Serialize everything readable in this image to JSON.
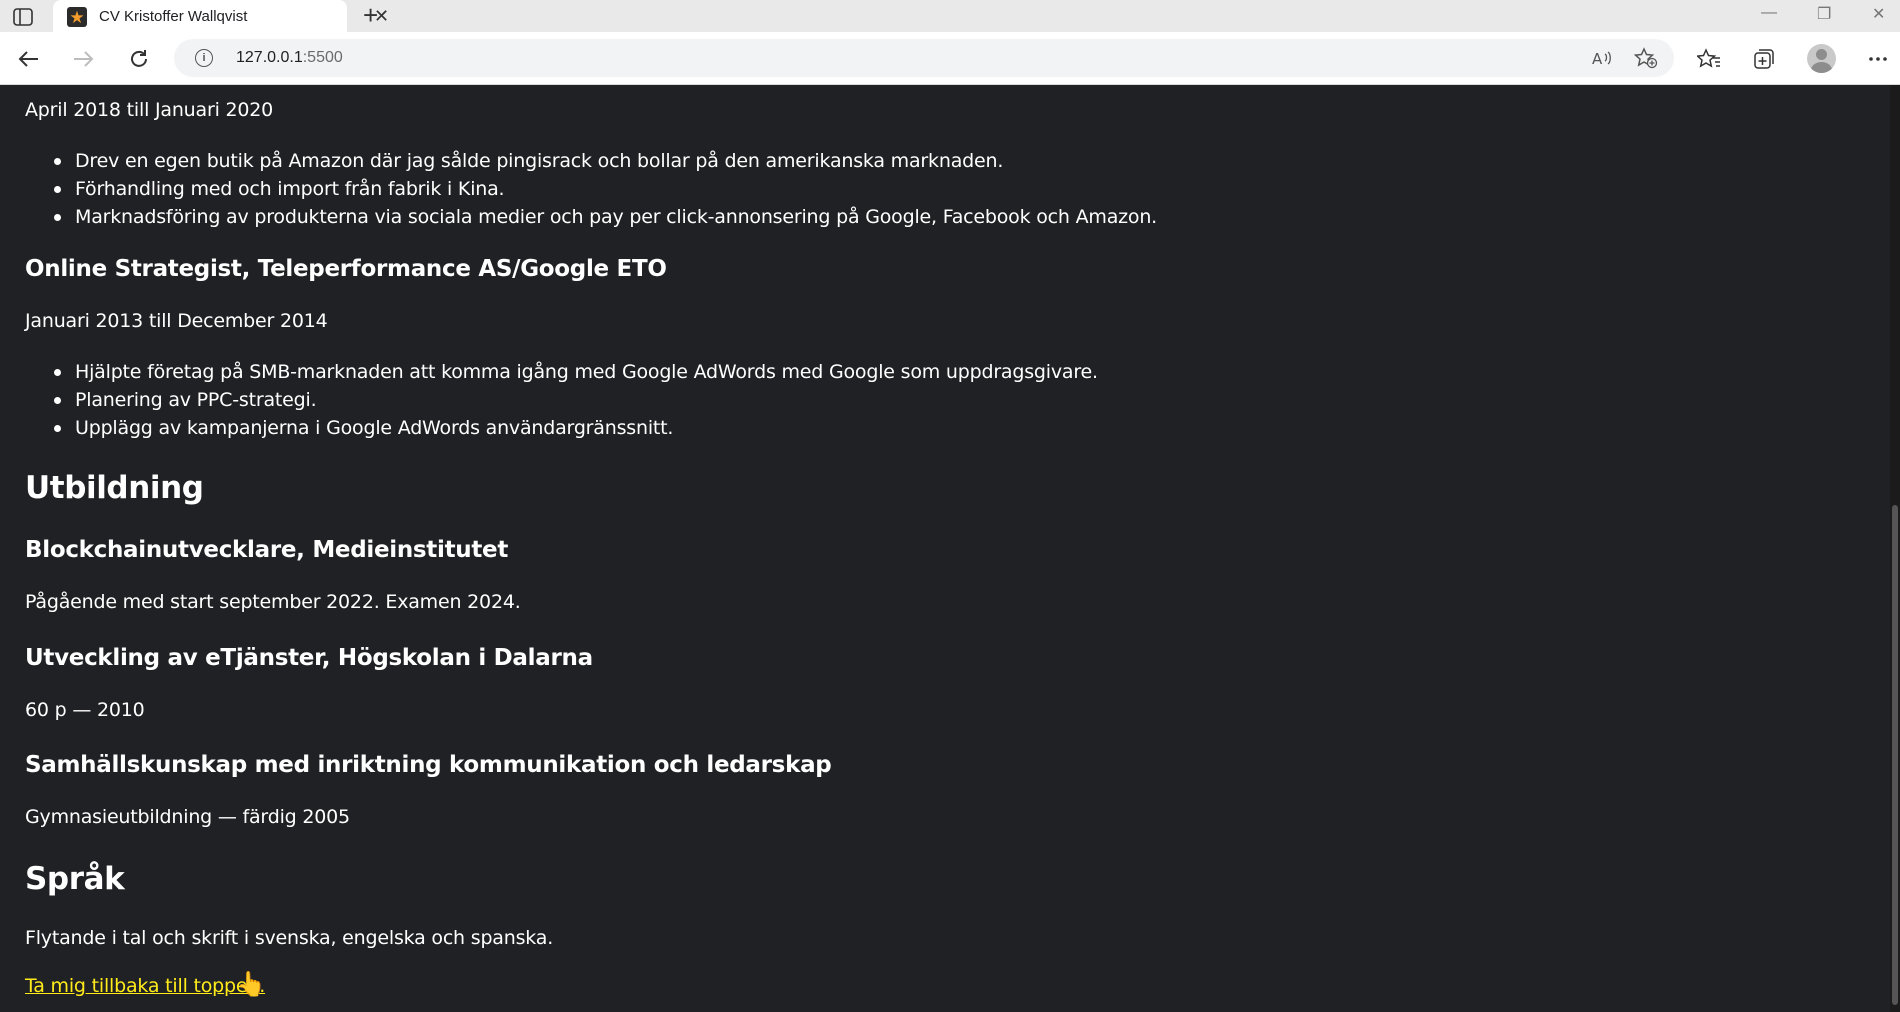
{
  "browser": {
    "tab_title": "CV Kristoffer Wallqvist",
    "new_tab_label": "+",
    "url_host": "127.0.0.1",
    "url_port": ":5500"
  },
  "page": {
    "job1_dates": "April 2018 till Januari 2020",
    "job1_bullets": [
      "Drev en egen butik på Amazon där jag sålde pingisrack och bollar på den amerikanska marknaden.",
      "Förhandling med och import från fabrik i Kina.",
      "Marknadsföring av produkterna via sociala medier och pay per click-annonsering på Google, Facebook och Amazon."
    ],
    "job2_title": "Online Strategist, Teleperformance AS/Google ETO",
    "job2_dates": "Januari 2013 till December 2014",
    "job2_bullets": [
      "Hjälpte företag på SMB-marknaden att komma igång med Google AdWords med Google som uppdragsgivare.",
      "Planering av PPC-strategi.",
      "Upplägg av kampanjerna i Google AdWords användargränssnitt."
    ],
    "education_heading": "Utbildning",
    "edu1_title": "Blockchainutvecklare, Medieinstitutet",
    "edu1_text": "Pågående med start september 2022. Examen 2024.",
    "edu2_title": "Utveckling av eTjänster, Högskolan i Dalarna",
    "edu2_text": "60 p — 2010",
    "edu3_title": "Samhällskunskap med inriktning kommunikation och ledarskap",
    "edu3_text": "Gymnasieutbildning — färdig 2005",
    "language_heading": "Språk",
    "language_text": "Flytande i tal och skrift i svenska, engelska och spanska.",
    "back_to_top": "Ta mig tillbaka till toppen."
  },
  "colors": {
    "page_background": "#202124",
    "text": "#ffffff",
    "link": "#ffeb1a"
  },
  "icons": [
    "tab-actions-icon",
    "favicon-star-icon",
    "close-icon",
    "back-arrow-icon",
    "forward-arrow-icon",
    "reload-icon",
    "info-icon",
    "read-aloud-icon",
    "add-favorite-icon",
    "favorites-icon",
    "collections-icon",
    "profile-icon",
    "more-icon",
    "pointer-hand-icon"
  ]
}
